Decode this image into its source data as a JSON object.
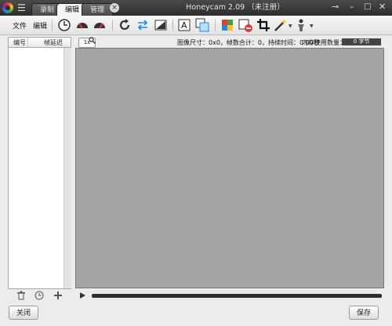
{
  "window": {
    "title": "Honeycam 2.09 （未注册）",
    "tabs": [
      "录制",
      "编辑",
      "管理"
    ],
    "active_tab": "编辑",
    "pin_icon": "pin-icon",
    "minimize": "–",
    "maximize": "□",
    "close": "✕"
  },
  "menu": {
    "file": "文件",
    "edit": "编辑"
  },
  "list_panel": {
    "col_number": "编号",
    "col_delay": "帧延迟"
  },
  "canvas_info": {
    "zoom_label": "1x",
    "info": "图像尺寸：0x0，帧数合计：0，持续时间：0.00秒",
    "memory_label": "内存使用数量：",
    "memory_value": "0 字节"
  },
  "footer": {
    "close_label": "关闭",
    "save_label": "保存"
  }
}
